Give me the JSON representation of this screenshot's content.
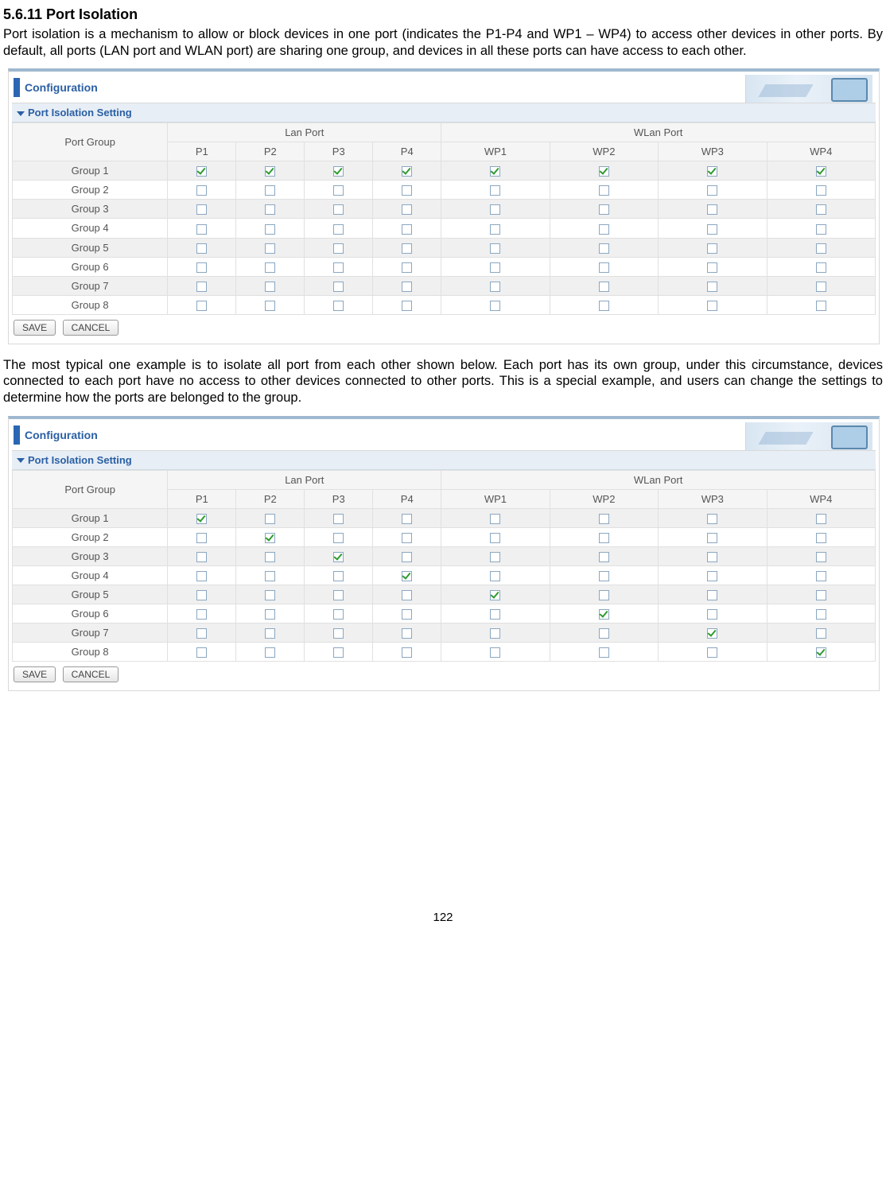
{
  "doc": {
    "heading": "5.6.11 Port Isolation",
    "para1": "Port isolation is a mechanism to allow or block devices in one port (indicates the P1-P4 and WP1 – WP4) to access other devices in other ports. By default, all ports (LAN port and WLAN port) are sharing one group, and devices in all these ports can have access to each other.",
    "para2": "The most typical one example is to isolate all port from each other shown below. Each port has its own group, under this circumstance, devices connected to each port have no access to other devices connected to other ports. This is a special example, and users can change the settings to determine how the ports are belonged to the group.",
    "page_number": "122"
  },
  "ui": {
    "configuration_label": "Configuration",
    "section_title": "Port Isolation Setting",
    "col_portgroup": "Port Group",
    "col_lanport": "Lan Port",
    "col_wlanport": "WLan Port",
    "ports": [
      "P1",
      "P2",
      "P3",
      "P4",
      "WP1",
      "WP2",
      "WP3",
      "WP4"
    ],
    "groups": [
      "Group 1",
      "Group 2",
      "Group 3",
      "Group 4",
      "Group 5",
      "Group 6",
      "Group 7",
      "Group 8"
    ],
    "save_label": "SAVE",
    "cancel_label": "CANCEL"
  },
  "table1_checked": [
    [
      true,
      true,
      true,
      true,
      true,
      true,
      true,
      true
    ],
    [
      false,
      false,
      false,
      false,
      false,
      false,
      false,
      false
    ],
    [
      false,
      false,
      false,
      false,
      false,
      false,
      false,
      false
    ],
    [
      false,
      false,
      false,
      false,
      false,
      false,
      false,
      false
    ],
    [
      false,
      false,
      false,
      false,
      false,
      false,
      false,
      false
    ],
    [
      false,
      false,
      false,
      false,
      false,
      false,
      false,
      false
    ],
    [
      false,
      false,
      false,
      false,
      false,
      false,
      false,
      false
    ],
    [
      false,
      false,
      false,
      false,
      false,
      false,
      false,
      false
    ]
  ],
  "table2_checked": [
    [
      true,
      false,
      false,
      false,
      false,
      false,
      false,
      false
    ],
    [
      false,
      true,
      false,
      false,
      false,
      false,
      false,
      false
    ],
    [
      false,
      false,
      true,
      false,
      false,
      false,
      false,
      false
    ],
    [
      false,
      false,
      false,
      true,
      false,
      false,
      false,
      false
    ],
    [
      false,
      false,
      false,
      false,
      true,
      false,
      false,
      false
    ],
    [
      false,
      false,
      false,
      false,
      false,
      true,
      false,
      false
    ],
    [
      false,
      false,
      false,
      false,
      false,
      false,
      true,
      false
    ],
    [
      false,
      false,
      false,
      false,
      false,
      false,
      false,
      true
    ]
  ]
}
